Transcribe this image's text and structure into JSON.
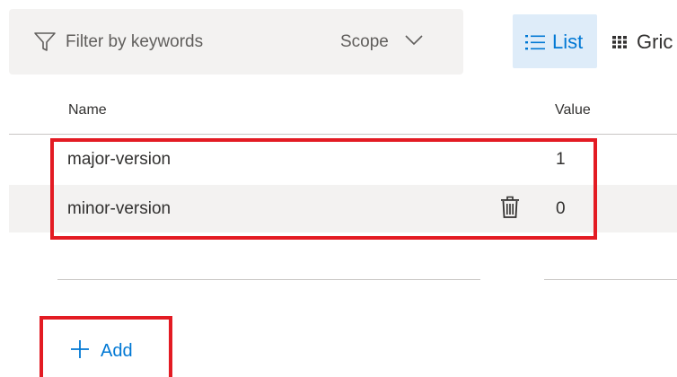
{
  "toolbar": {
    "filter_placeholder": "Filter by keywords",
    "scope_label": "Scope",
    "list_label": "List",
    "grid_label": "Gric"
  },
  "table": {
    "headers": {
      "name": "Name",
      "value": "Value"
    },
    "rows": [
      {
        "name": "major-version",
        "value": "1"
      },
      {
        "name": "minor-version",
        "value": "0"
      }
    ]
  },
  "actions": {
    "add_label": "Add"
  },
  "colors": {
    "accent": "#0078d4",
    "highlight": "#e31b23",
    "selected_bg": "#deecf9",
    "surface": "#f3f2f1"
  },
  "icons": [
    "filter-icon",
    "chevron-down-icon",
    "list-icon",
    "grid-icon",
    "trash-icon",
    "plus-icon"
  ]
}
